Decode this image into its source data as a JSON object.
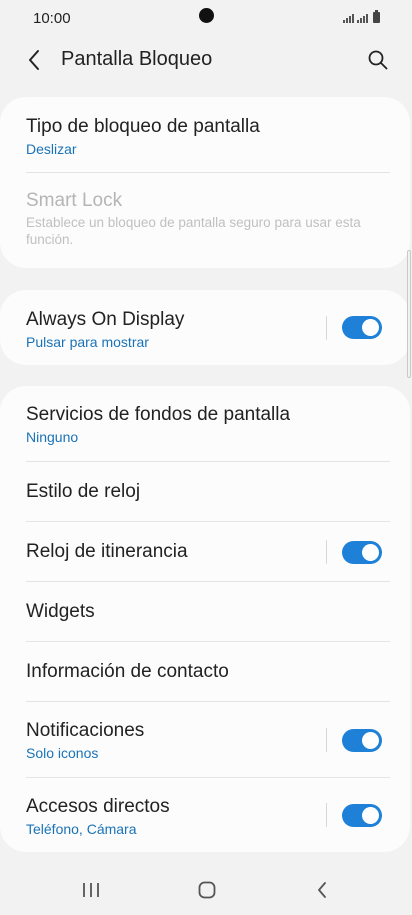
{
  "status_bar": {
    "time": "10:00"
  },
  "header": {
    "title": "Pantalla Bloqueo"
  },
  "card1": {
    "items": [
      {
        "title": "Tipo de bloqueo de pantalla",
        "subtitle": "Deslizar"
      },
      {
        "title": "Smart Lock",
        "subtitle": "Establece un bloqueo de pantalla seguro para usar esta función."
      }
    ]
  },
  "card2": {
    "items": [
      {
        "title": "Always On Display",
        "subtitle": "Pulsar para mostrar",
        "toggle": true
      }
    ]
  },
  "card3": {
    "items": [
      {
        "title": "Servicios de fondos de pantalla",
        "subtitle": "Ninguno"
      },
      {
        "title": "Estilo de reloj"
      },
      {
        "title": "Reloj de itinerancia",
        "toggle": true
      },
      {
        "title": "Widgets"
      },
      {
        "title": "Información de contacto"
      },
      {
        "title": "Notificaciones",
        "subtitle": "Solo iconos",
        "toggle": true
      },
      {
        "title": "Accesos directos",
        "subtitle": "Teléfono, Cámara",
        "toggle": true
      }
    ]
  },
  "colors": {
    "accent": "#1e80d6",
    "link": "#1a73b8",
    "background": "#f2f2f2",
    "card": "#fcfcfc",
    "disabled_text": "#b5b5b5"
  },
  "icons": {
    "back": "chevron-left-icon",
    "search": "search-icon",
    "nav_recents": "recent-apps-icon",
    "nav_home": "home-icon",
    "nav_back": "back-icon"
  }
}
